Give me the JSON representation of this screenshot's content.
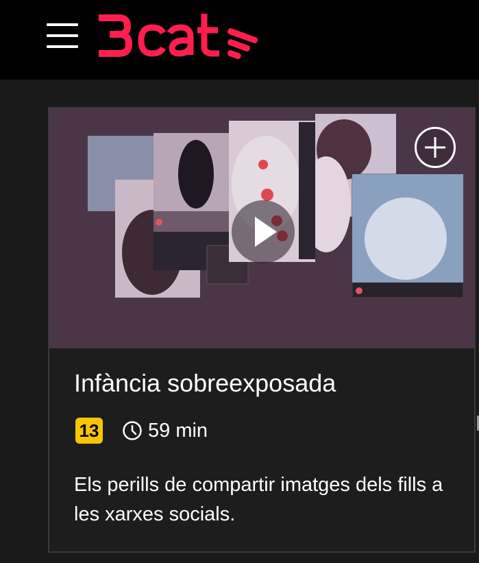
{
  "header": {
    "menu_icon": "hamburger-menu-icon",
    "logo_text": "3cat",
    "logo_color": "#ff1e4f"
  },
  "card": {
    "title": "Infància sobreexposada",
    "age_rating": "13",
    "age_badge_color": "#f7c600",
    "duration": "59 min",
    "duration_icon": "clock-icon",
    "description": "Els perills de compartir imatges dels fills a les xarxes socials.",
    "add_icon": "plus-circle-icon",
    "play_icon": "play-icon"
  }
}
